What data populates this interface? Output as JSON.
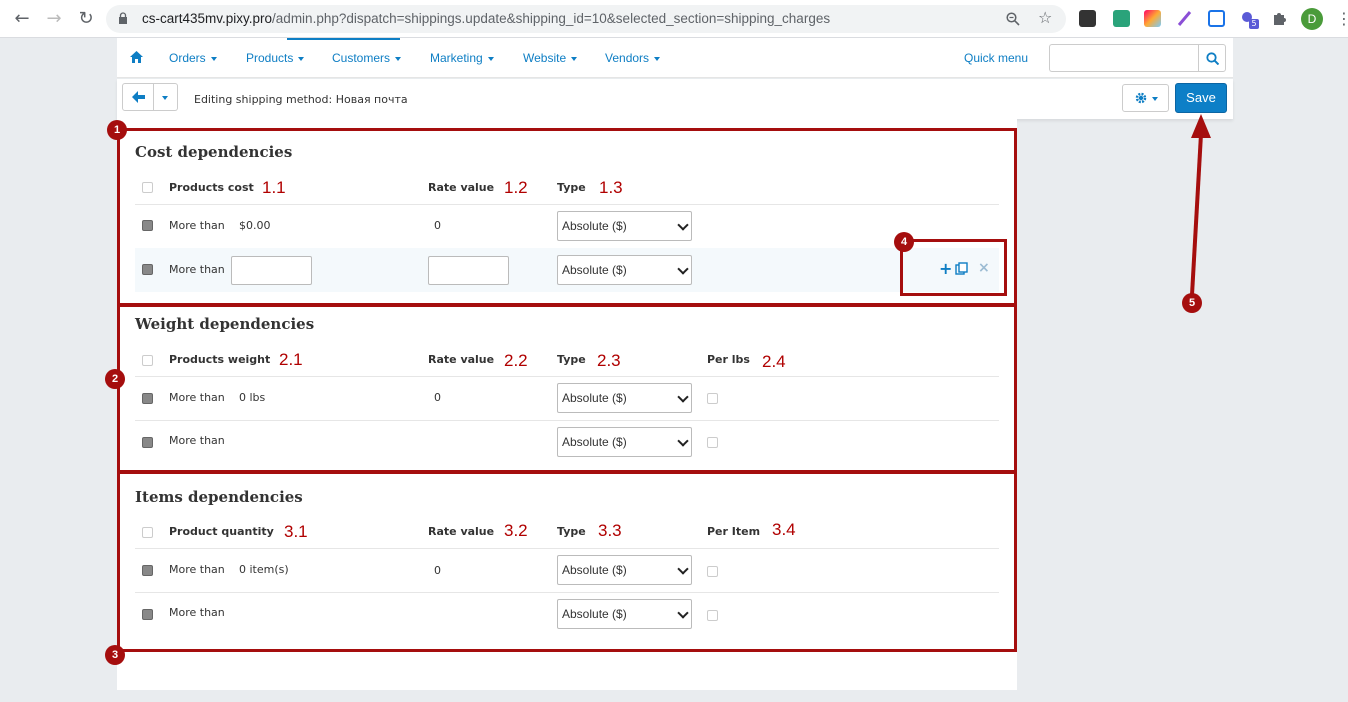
{
  "browser": {
    "url_host": "cs-cart435mv.pixy.pro",
    "url_path": "/admin.php?dispatch=shippings.update&shipping_id=10&selected_section=shipping_charges",
    "profile_initial": "D",
    "badge_count": "5"
  },
  "nav": {
    "items": [
      "Orders",
      "Products",
      "Customers",
      "Marketing",
      "Website",
      "Vendors"
    ],
    "quick_menu": "Quick menu",
    "search_placeholder": ""
  },
  "toolbar": {
    "title": "Editing shipping method: Новая почта",
    "save_label": "Save"
  },
  "cost": {
    "title": "Cost dependencies",
    "headers": [
      "Products cost",
      "Rate value",
      "Type"
    ],
    "row1": {
      "label": "More than",
      "amount": "$0.00",
      "rate": "0",
      "type": "Absolute ($)"
    },
    "row2": {
      "label": "More than",
      "amount": "",
      "rate": "",
      "type": "Absolute ($)"
    }
  },
  "weight": {
    "title": "Weight dependencies",
    "headers": [
      "Products weight",
      "Rate value",
      "Type",
      "Per lbs"
    ],
    "row1": {
      "label": "More than",
      "amount": "0 lbs",
      "rate": "0",
      "type": "Absolute ($)"
    },
    "row2": {
      "label": "More than",
      "type": "Absolute ($)"
    }
  },
  "items": {
    "title": "Items dependencies",
    "headers": [
      "Product quantity",
      "Rate value",
      "Type",
      "Per Item"
    ],
    "row1": {
      "label": "More than",
      "amount": "0 item(s)",
      "rate": "0",
      "type": "Absolute ($)"
    },
    "row2": {
      "label": "More than",
      "type": "Absolute ($)"
    }
  },
  "annotations": {
    "badges": [
      "1",
      "2",
      "3",
      "4",
      "5"
    ],
    "cost_labels": [
      "1.1",
      "1.2",
      "1.3"
    ],
    "weight_labels": [
      "2.1",
      "2.2",
      "2.3",
      "2.4"
    ],
    "items_labels": [
      "3.1",
      "3.2",
      "3.3",
      "3.4"
    ]
  },
  "colors": {
    "accent": "#0d7fc7",
    "annotation": "#a50e0e"
  }
}
